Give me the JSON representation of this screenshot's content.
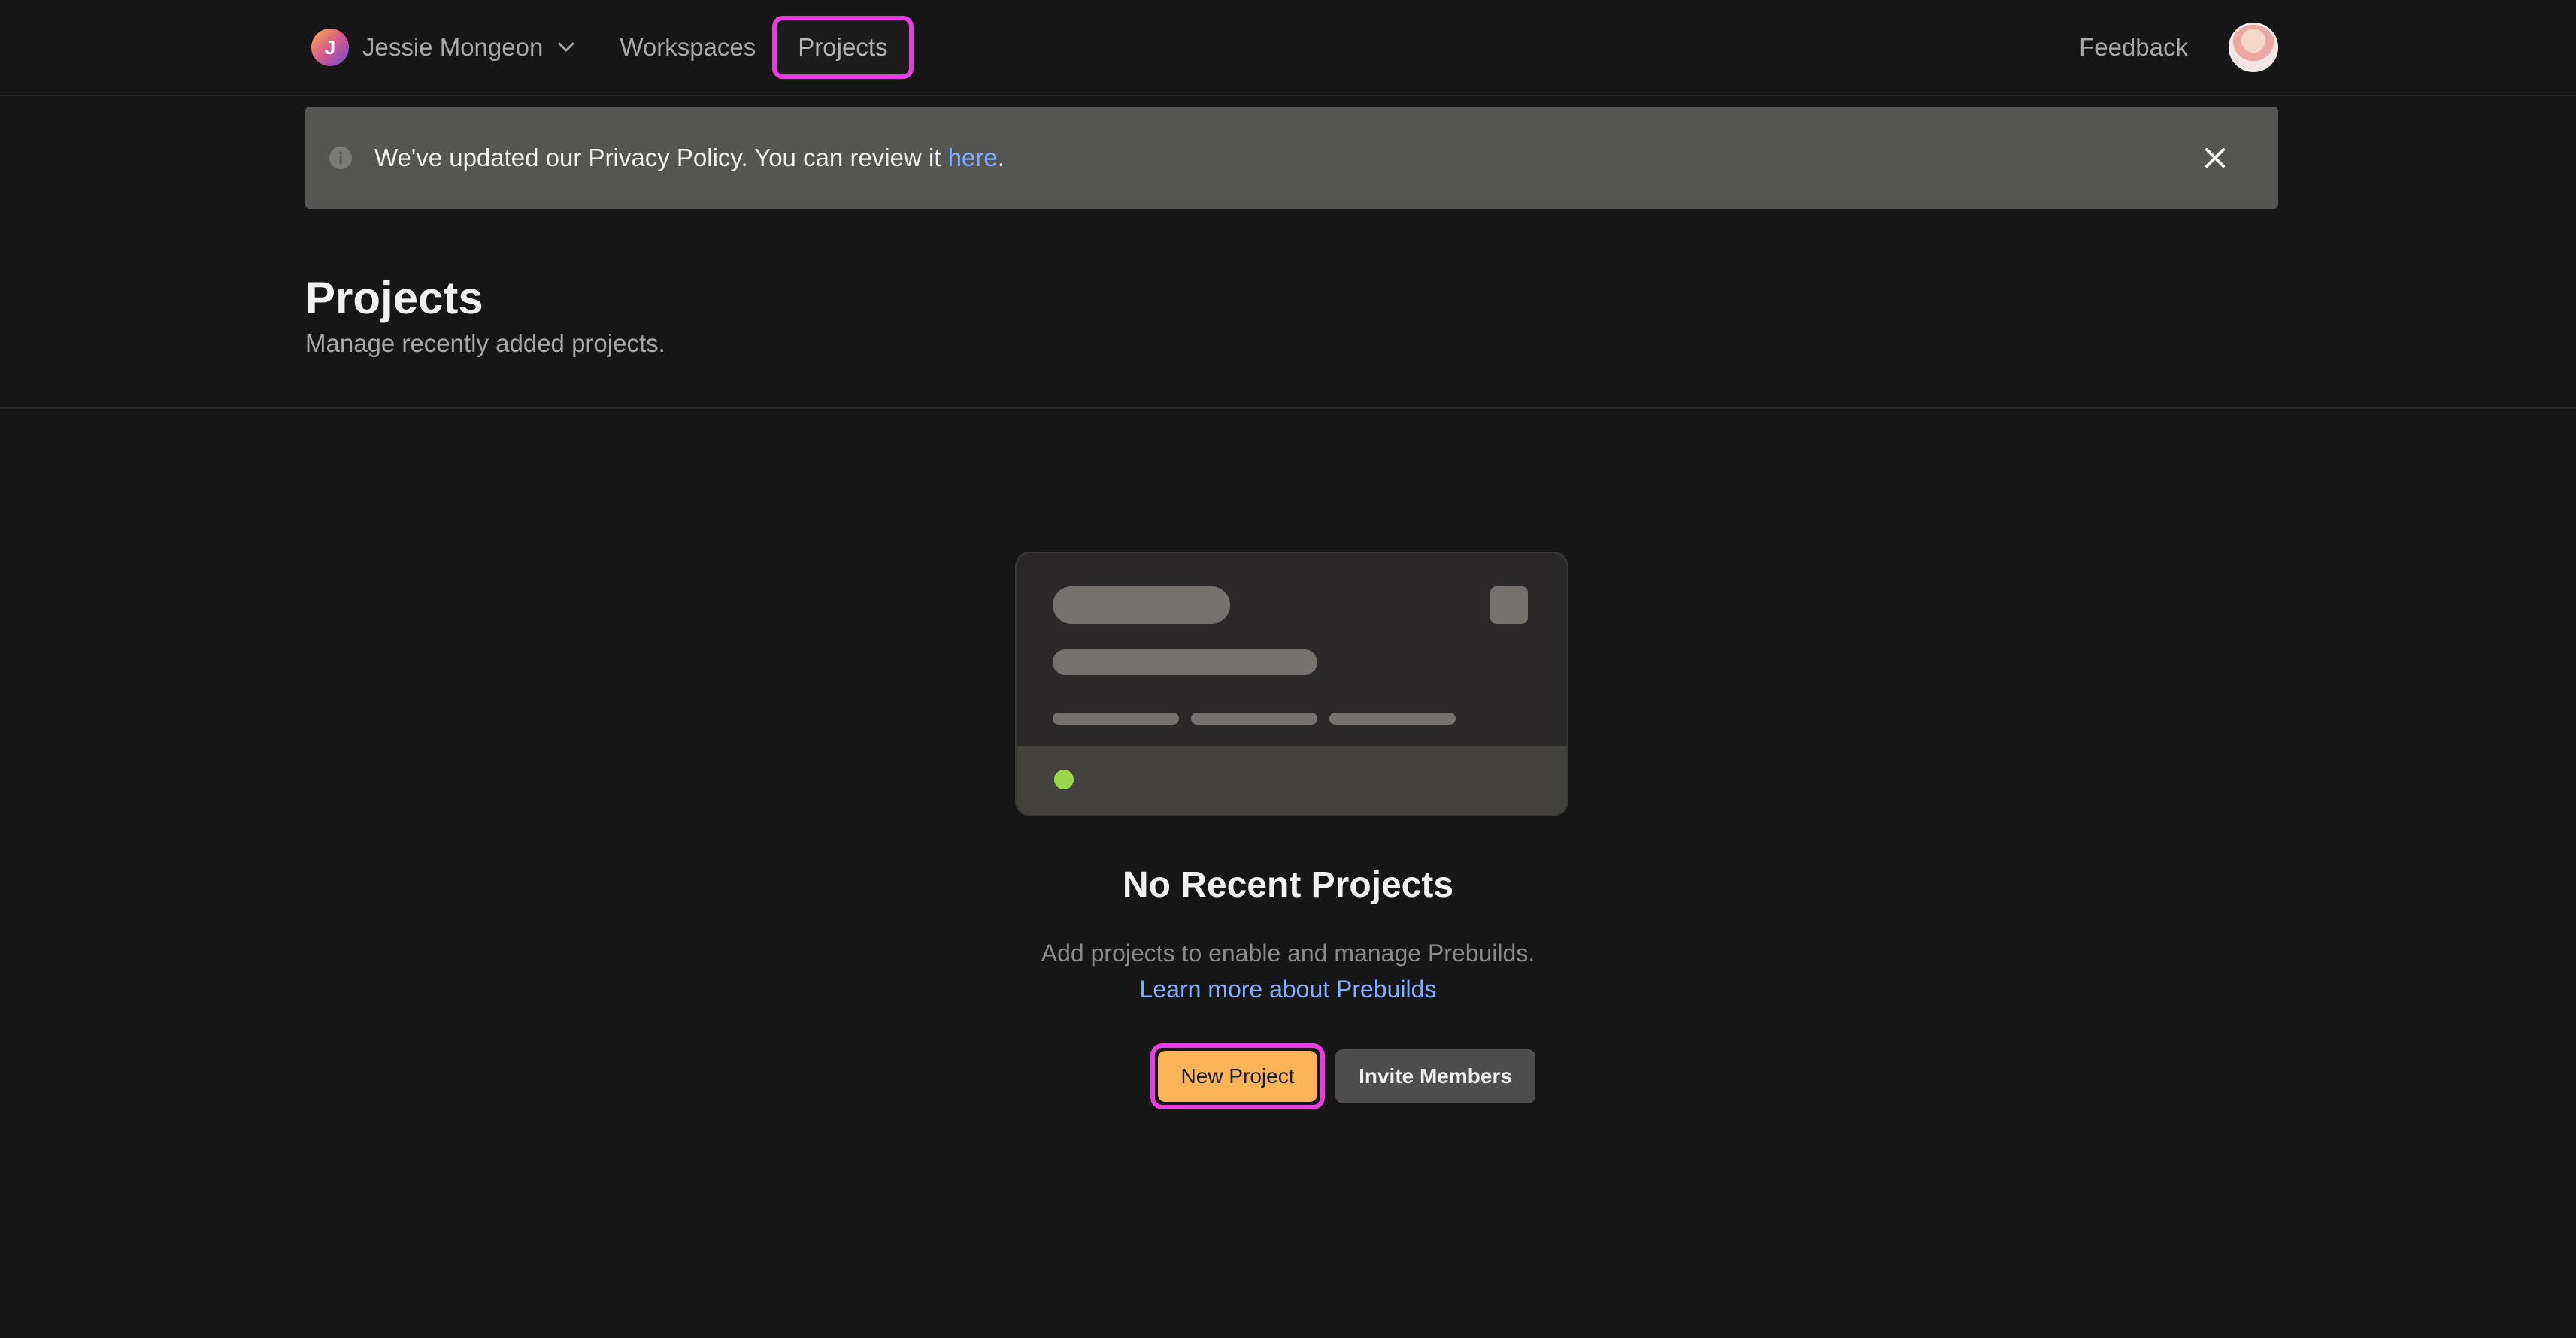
{
  "nav": {
    "org_initial": "J",
    "org_name": "Jessie Mongeon",
    "workspaces_label": "Workspaces",
    "projects_label": "Projects",
    "feedback_label": "Feedback"
  },
  "banner": {
    "text_before": "We've updated our Privacy Policy. You can review it ",
    "link_text": "here",
    "text_after": "."
  },
  "header": {
    "title": "Projects",
    "subtitle": "Manage recently added projects."
  },
  "empty_state": {
    "title": "No Recent Projects",
    "description": "Add projects to enable and manage Prebuilds.",
    "link_text": "Learn more about Prebuilds",
    "primary_button": "New Project",
    "secondary_button": "Invite Members"
  },
  "colors": {
    "background": "#161616",
    "accent_orange": "#fcb458",
    "link_blue": "#7fb0ff",
    "highlight_magenta": "#e83de0",
    "status_green": "#9ad94a"
  }
}
